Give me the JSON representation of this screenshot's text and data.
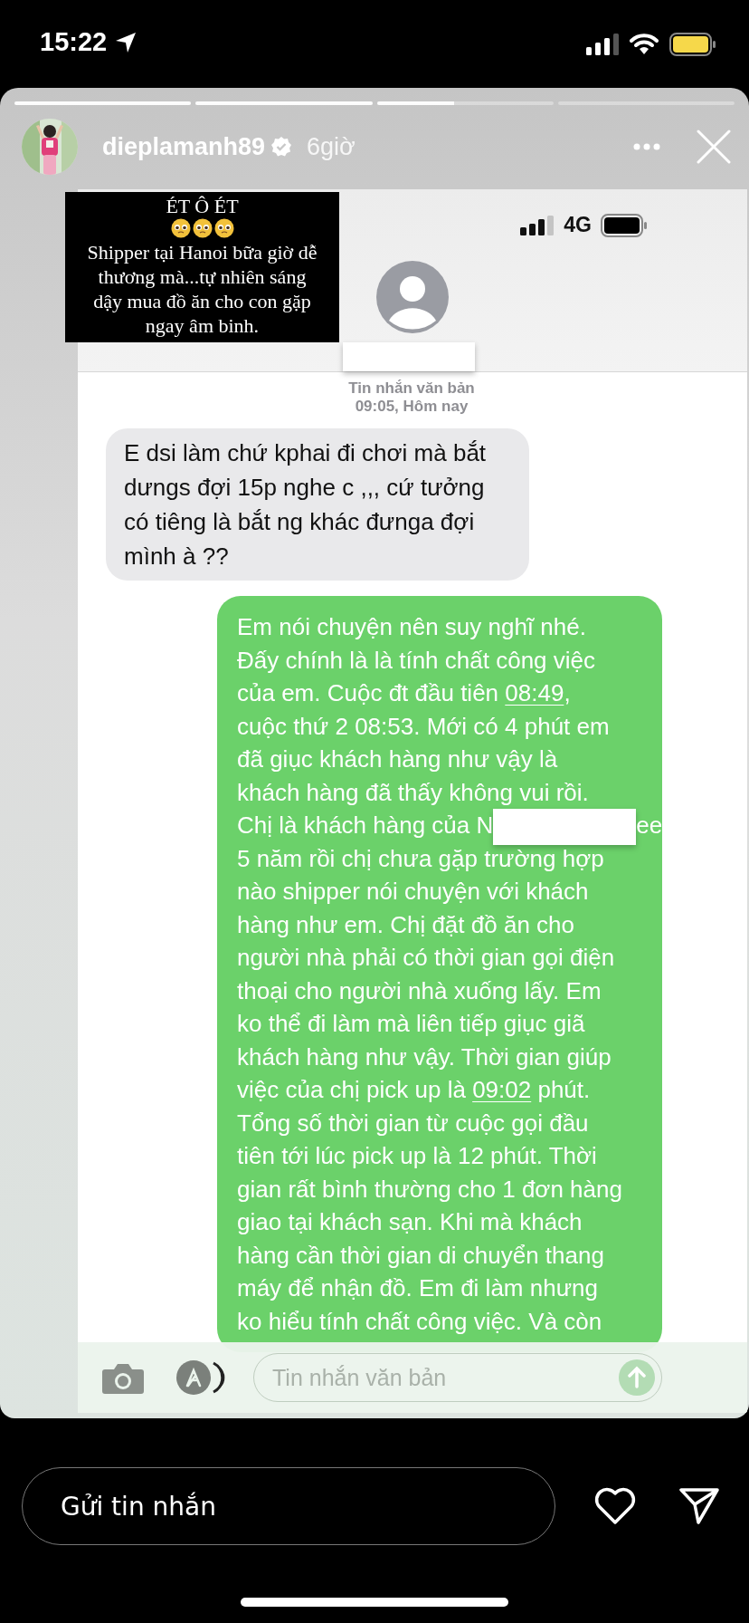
{
  "status_bar": {
    "time": "15:22"
  },
  "story_progress": [
    {
      "level": 1
    },
    {
      "level": 1
    },
    {
      "level": 0.44
    },
    {
      "level": 0
    }
  ],
  "story_header": {
    "username": "dieplamanh89",
    "verified": true,
    "time_ago": "6giờ"
  },
  "caption": {
    "title": "ÉT Ô ÉT",
    "lines": [
      "Shipper tại Hanoi bữa giờ dễ",
      "thương mà...tự nhiên sáng",
      "dậy mua đồ ăn cho con gặp",
      "ngay âm binh."
    ]
  },
  "screenshot": {
    "status_bar": {
      "network": "4G"
    },
    "contact": {
      "name_redacted": true
    },
    "timestamp": {
      "label": "Tin nhắn văn bản",
      "time": "09:05, Hôm nay"
    },
    "messages": [
      {
        "kind": "incoming",
        "lines": [
          "E dsi làm chứ kphai đi chơi mà bắt",
          "dưngs đợi 15p nghe c ,,, cứ tưởng",
          "có tiêng là bắt ng khác đưnga đợi",
          "mình à ??"
        ]
      },
      {
        "kind": "outgoing",
        "lines": [
          "Em nói chuyện nên suy nghĩ nhé.",
          "Đấy chính là là tính chất công việc",
          [
            {
              "text": "của em. Cuộc đt đầu tiên "
            },
            {
              "text": "08:49",
              "kind": "link"
            },
            {
              "text": ","
            }
          ],
          "cuộc thứ 2 08:53. Mới có 4 phút em",
          "đã giục khách hàng như vậy là",
          "khách hàng đã thấy không vui rồi.",
          [
            {
              "text": "Chị là khách hàng của N"
            },
            {
              "kind": "redaction"
            },
            {
              "text": "ee"
            }
          ],
          "5 năm rồi chị chưa gặp trường hợp",
          "nào shipper nói chuyện với khách",
          "hàng như em. Chị đặt đồ ăn cho",
          "người nhà phải có thời gian gọi điện",
          "thoại cho người nhà xuống lấy. Em",
          "ko thể đi làm mà liên tiếp giục giã",
          "khách hàng như vậy. Thời gian giúp",
          [
            {
              "text": "việc của chị pick up là "
            },
            {
              "text": "09:02",
              "kind": "link"
            },
            {
              "text": " phút."
            }
          ],
          "Tổng số thời gian từ cuộc gọi đầu",
          "tiên tới lúc pick up là 12 phút. Thời",
          "gian rất bình thường cho 1 đơn hàng",
          "giao tại khách sạn. Khi mà khách",
          "hàng cần thời gian di chuyển thang",
          "máy để nhận đồ. Em đi làm nhưng",
          "ko hiểu tính chất công việc. Và còn"
        ]
      }
    ],
    "composer": {
      "placeholder": "Tin nhắn văn bản"
    }
  },
  "reply_bar": {
    "placeholder": "Gửi tin nhắn"
  }
}
